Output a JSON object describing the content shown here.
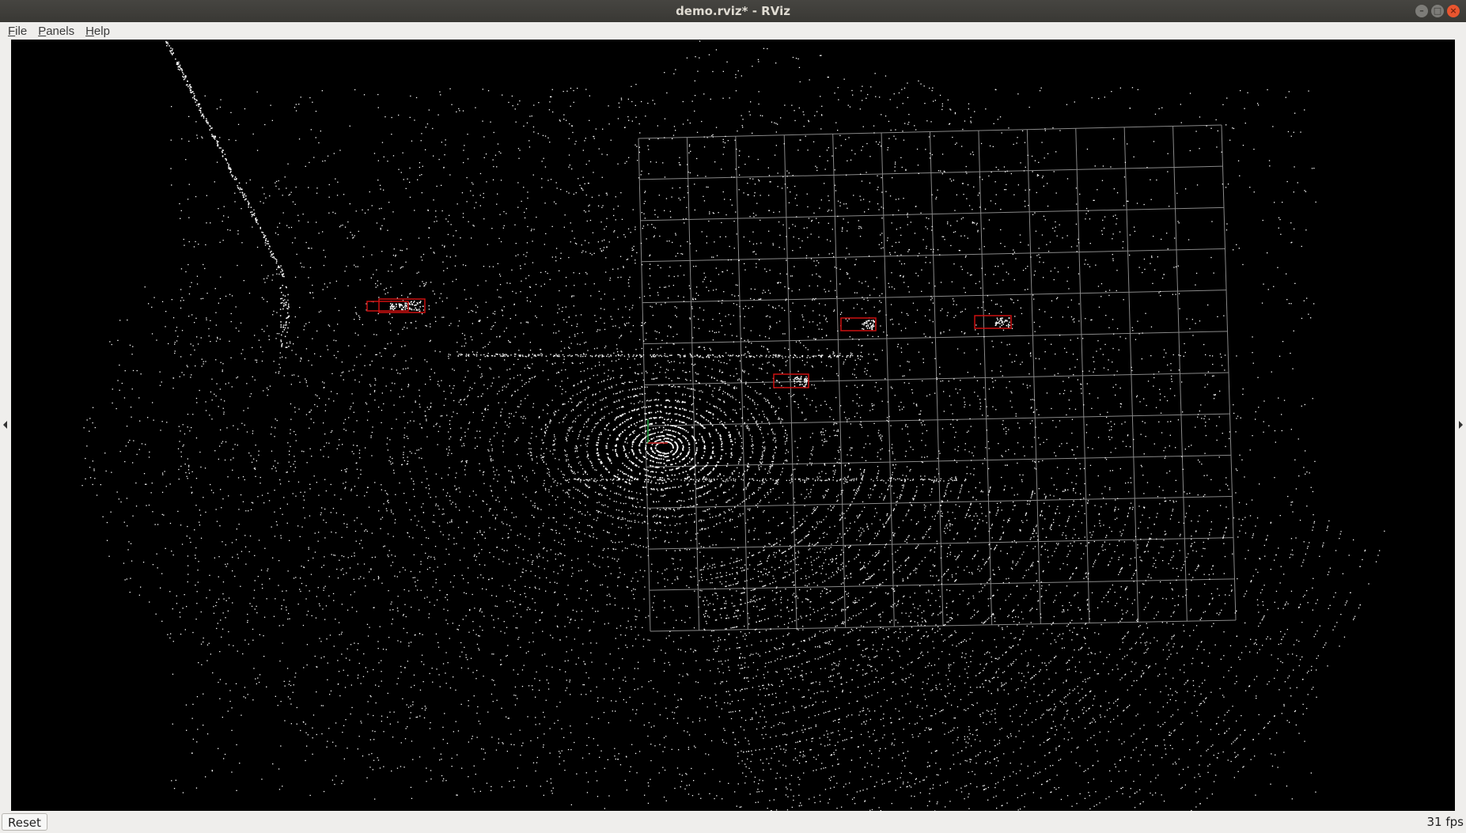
{
  "window": {
    "title": "demo.rviz* - RViz",
    "buttons": [
      "minimize-icon",
      "maximize-icon",
      "close-icon"
    ]
  },
  "menu": {
    "items": [
      {
        "mnemonic": "F",
        "rest": "ile"
      },
      {
        "mnemonic": "P",
        "rest": "anels"
      },
      {
        "mnemonic": "H",
        "rest": "elp"
      }
    ]
  },
  "viewport": {
    "background": "#000000",
    "grid_color": "#a0a0a0",
    "point_color": "#ffffff",
    "bbox_color": "#cc1111",
    "grid": {
      "rows": 12,
      "cols": 12
    },
    "bounding_boxes_count": 5
  },
  "statusbar": {
    "reset_label": "Reset",
    "fps": "31 fps"
  }
}
